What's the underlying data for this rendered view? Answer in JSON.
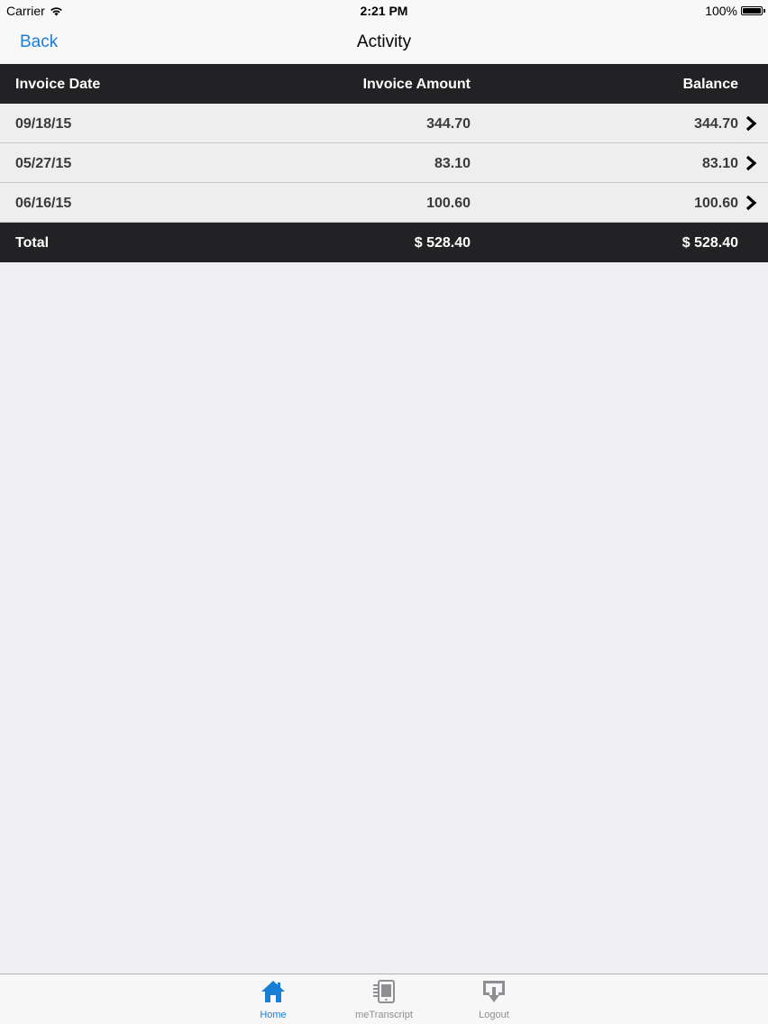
{
  "status_bar": {
    "carrier": "Carrier",
    "time": "2:21 PM",
    "battery": "100%"
  },
  "nav": {
    "back_label": "Back",
    "title": "Activity"
  },
  "table": {
    "headers": [
      "Invoice Date",
      "Invoice Amount",
      "Balance"
    ],
    "rows": [
      {
        "date": "09/18/15",
        "amount": "344.70",
        "balance": "344.70"
      },
      {
        "date": "05/27/15",
        "amount": "83.10",
        "balance": "83.10"
      },
      {
        "date": "06/16/15",
        "amount": "100.60",
        "balance": "100.60"
      }
    ],
    "total": {
      "label": "Total",
      "amount": "$ 528.40",
      "balance": "$ 528.40"
    }
  },
  "tab_bar": {
    "tabs": [
      {
        "label": "Home",
        "icon": "home-icon",
        "selected": true
      },
      {
        "label": "meTranscript",
        "icon": "transcript-icon",
        "selected": false
      },
      {
        "label": "Logout",
        "icon": "logout-icon",
        "selected": false
      }
    ]
  },
  "colors": {
    "accent": "#1a7fd4",
    "header_bg": "#222224",
    "row_bg": "#eeeeef",
    "page_bg": "#efeff4"
  }
}
